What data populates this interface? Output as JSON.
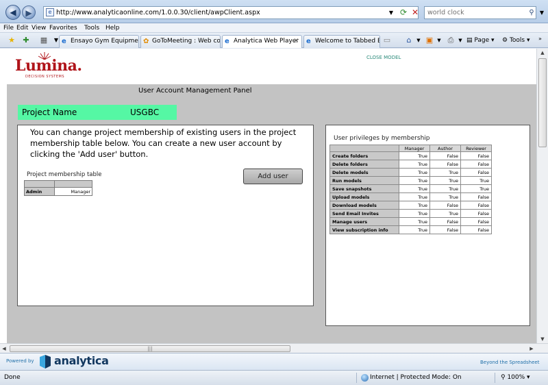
{
  "browser": {
    "url": "http://www.analyticaonline.com/1.0.0.30/client/awpClient.aspx",
    "search_value": "world clock",
    "menu": [
      "File",
      "Edit",
      "View",
      "Favorites",
      "Tools",
      "Help"
    ],
    "tabs": [
      {
        "label": "Ensayo Gym Equipmen...",
        "active": false
      },
      {
        "label": "GoToMeeting : Web co...",
        "active": false
      },
      {
        "label": "Analytica Web Player",
        "active": true
      },
      {
        "label": "Welcome to Tabbed Br...",
        "active": false
      }
    ],
    "commands": {
      "page": "Page",
      "tools": "Tools"
    },
    "status": {
      "left": "Done",
      "zone": "Internet | Protected Mode: On",
      "zoom": "100%"
    }
  },
  "app": {
    "logo_text": "Lumina.",
    "logo_sub": "DECISION SYSTEMS",
    "close_model": "CLOSE MODEL",
    "panel_title": "User Account Management Panel",
    "project_label": "Project Name",
    "project_value": "USGBC",
    "intro": "You can change project membership of existing users in the project membership table below.  You can create a new user account by clicking the 'Add user' button.",
    "membership_title": "Project membership table",
    "add_user_label": "Add user",
    "membership_rows": [
      {
        "user": "Admin",
        "role": "Manager"
      }
    ],
    "privileges_title": "User privileges by membership",
    "privilege_columns": [
      "Manager",
      "Author",
      "Reviewer"
    ],
    "privileges": [
      {
        "name": "Create folders",
        "values": [
          "True",
          "False",
          "False"
        ]
      },
      {
        "name": "Delete folders",
        "values": [
          "True",
          "False",
          "False"
        ]
      },
      {
        "name": "Delete models",
        "values": [
          "True",
          "True",
          "False"
        ]
      },
      {
        "name": "Run models",
        "values": [
          "True",
          "True",
          "True"
        ]
      },
      {
        "name": "Save snapshots",
        "values": [
          "True",
          "True",
          "True"
        ]
      },
      {
        "name": "Upload models",
        "values": [
          "True",
          "True",
          "False"
        ]
      },
      {
        "name": "Download models",
        "values": [
          "True",
          "False",
          "False"
        ]
      },
      {
        "name": "Send Email Invites",
        "values": [
          "True",
          "True",
          "False"
        ]
      },
      {
        "name": "Manage users",
        "values": [
          "True",
          "False",
          "False"
        ]
      },
      {
        "name": "View subscription info",
        "values": [
          "True",
          "False",
          "False"
        ]
      }
    ],
    "footer": {
      "powered_by": "Powered by",
      "brand": "analytica",
      "tagline": "Beyond the Spreadsheet"
    }
  }
}
